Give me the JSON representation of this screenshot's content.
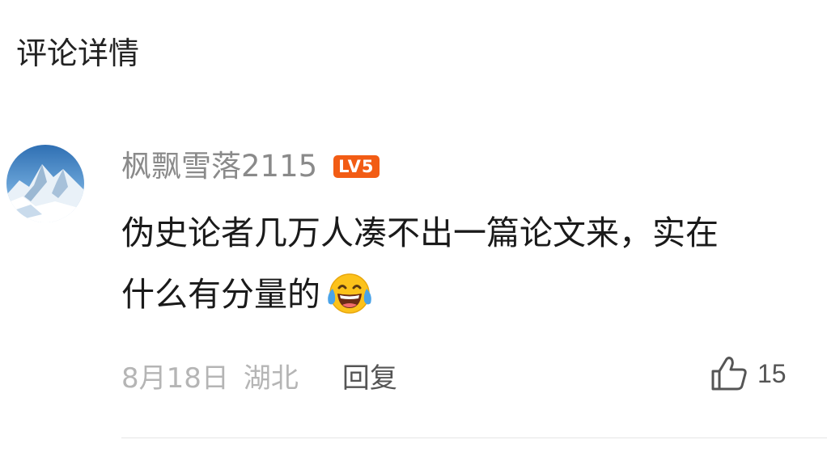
{
  "page": {
    "title": "评论详情"
  },
  "comment": {
    "author": {
      "name": "枫飘雪落2115",
      "level_badge": "LV5",
      "avatar_icon": "snow-mountain-avatar"
    },
    "text_lines": [
      "伪史论者几万人凑不出一篇论文来，实在",
      "什么有分量的"
    ],
    "emoji": "laughing-tears-emoji",
    "date": "8月18日",
    "location": "湖北",
    "reply_label": "回复",
    "like_count": "15",
    "like_icon": "thumbs-up-icon"
  },
  "colors": {
    "badge": "#f25c14",
    "username": "#8a8a8a",
    "meta": "#b5b5b5",
    "action": "#555555",
    "divider": "#e6e6e6"
  }
}
